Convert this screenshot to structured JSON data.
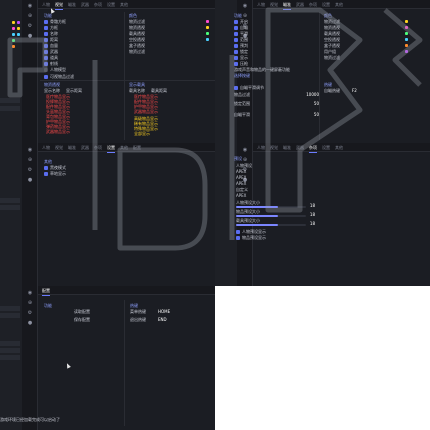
{
  "tabs": [
    "人物",
    "视觉",
    "瞄准",
    "武器",
    "杂项",
    "设置",
    "其他",
    "配置"
  ],
  "p1": {
    "sec_a": "功能",
    "items_a": [
      "骨骼方框",
      "方框",
      "名称",
      "距离",
      "血量",
      "武器",
      "道具",
      "射线",
      "人物模型"
    ],
    "sec_b": "颜色",
    "items_b": [
      "物资过滤",
      "物资透视",
      "载具透视",
      "空投透视",
      "盒子透视",
      "物资过滤"
    ],
    "check_line": "可视物品过滤",
    "sec_c": "物资透视",
    "items_c": [
      "显示名称",
      "显示距离"
    ],
    "sec_d": "显示载具",
    "items_d": [
      "载具名称",
      "载具距离"
    ],
    "red_items": [
      "医疗物品显示",
      "投掷物品显示",
      "配件物品显示",
      "头盔物品显示",
      "背包物品显示",
      "护甲物品显示",
      "弹药物品显示",
      "武器物品显示"
    ],
    "yel_items": [
      "高级物品显示",
      "稀有物品显示",
      "特殊物品显示",
      "全部显示"
    ]
  },
  "p2": {
    "sec_a": "功能",
    "items_a": [
      "开启",
      "自瞄",
      "平滑",
      "范围",
      "预判",
      "锁定",
      "显示",
      "压枪"
    ],
    "sec_b": "颜色",
    "items_b": [
      "物资过滤",
      "物资透视",
      "载具透视",
      "空投透视",
      "盒子透视",
      "用户组",
      "物资过滤"
    ],
    "filter": "游戏声音和物品的一键屏蔽功能",
    "sec_c": "选择按键",
    "check_line": "自瞄平滑调节",
    "items_c": [
      {
        "label": "物品过滤",
        "value": "10000"
      },
      {
        "label": "锁定范围",
        "value": "50"
      },
      {
        "label": "自瞄平滑",
        "value": "50"
      }
    ],
    "sec_d": "热键",
    "key_label": "自瞄热键",
    "key_value": "F2"
  },
  "p3": {
    "sec_a": "其他",
    "items_a": [
      "黑夜模式",
      "草地显示"
    ]
  },
  "p4": {
    "sec_a": "预设",
    "items_a": [
      "人物预设",
      "APEX",
      "APEX",
      "APEX",
      "自定义",
      "APEX"
    ],
    "sliders": [
      {
        "label": "人物预设大小",
        "value": "18"
      },
      {
        "label": "物品预设大小",
        "value": "18"
      },
      {
        "label": "载具预设大小",
        "value": "18"
      }
    ],
    "checks": [
      "人物预设显示",
      "物品预设显示"
    ]
  },
  "p5": {
    "sec_a": "功能",
    "items_a": [
      "读取配置",
      "保存配置"
    ],
    "sec_b": "热键",
    "key_rows": [
      {
        "label": "菜单热键",
        "value": "HOME"
      },
      {
        "label": "退出热键",
        "value": "END"
      }
    ],
    "tab": "配置",
    "footer": "游戏环境已经加载完成可以启动了"
  },
  "colors": {
    "accent": "#6b7cff",
    "red": "#ff4a4a",
    "yellow": "#ffd21f",
    "swatches": [
      "#ffd21f",
      "#ff4ad0",
      "#4ad0ff",
      "#4aff7a",
      "#ff8a2a",
      "#c04aff"
    ]
  }
}
